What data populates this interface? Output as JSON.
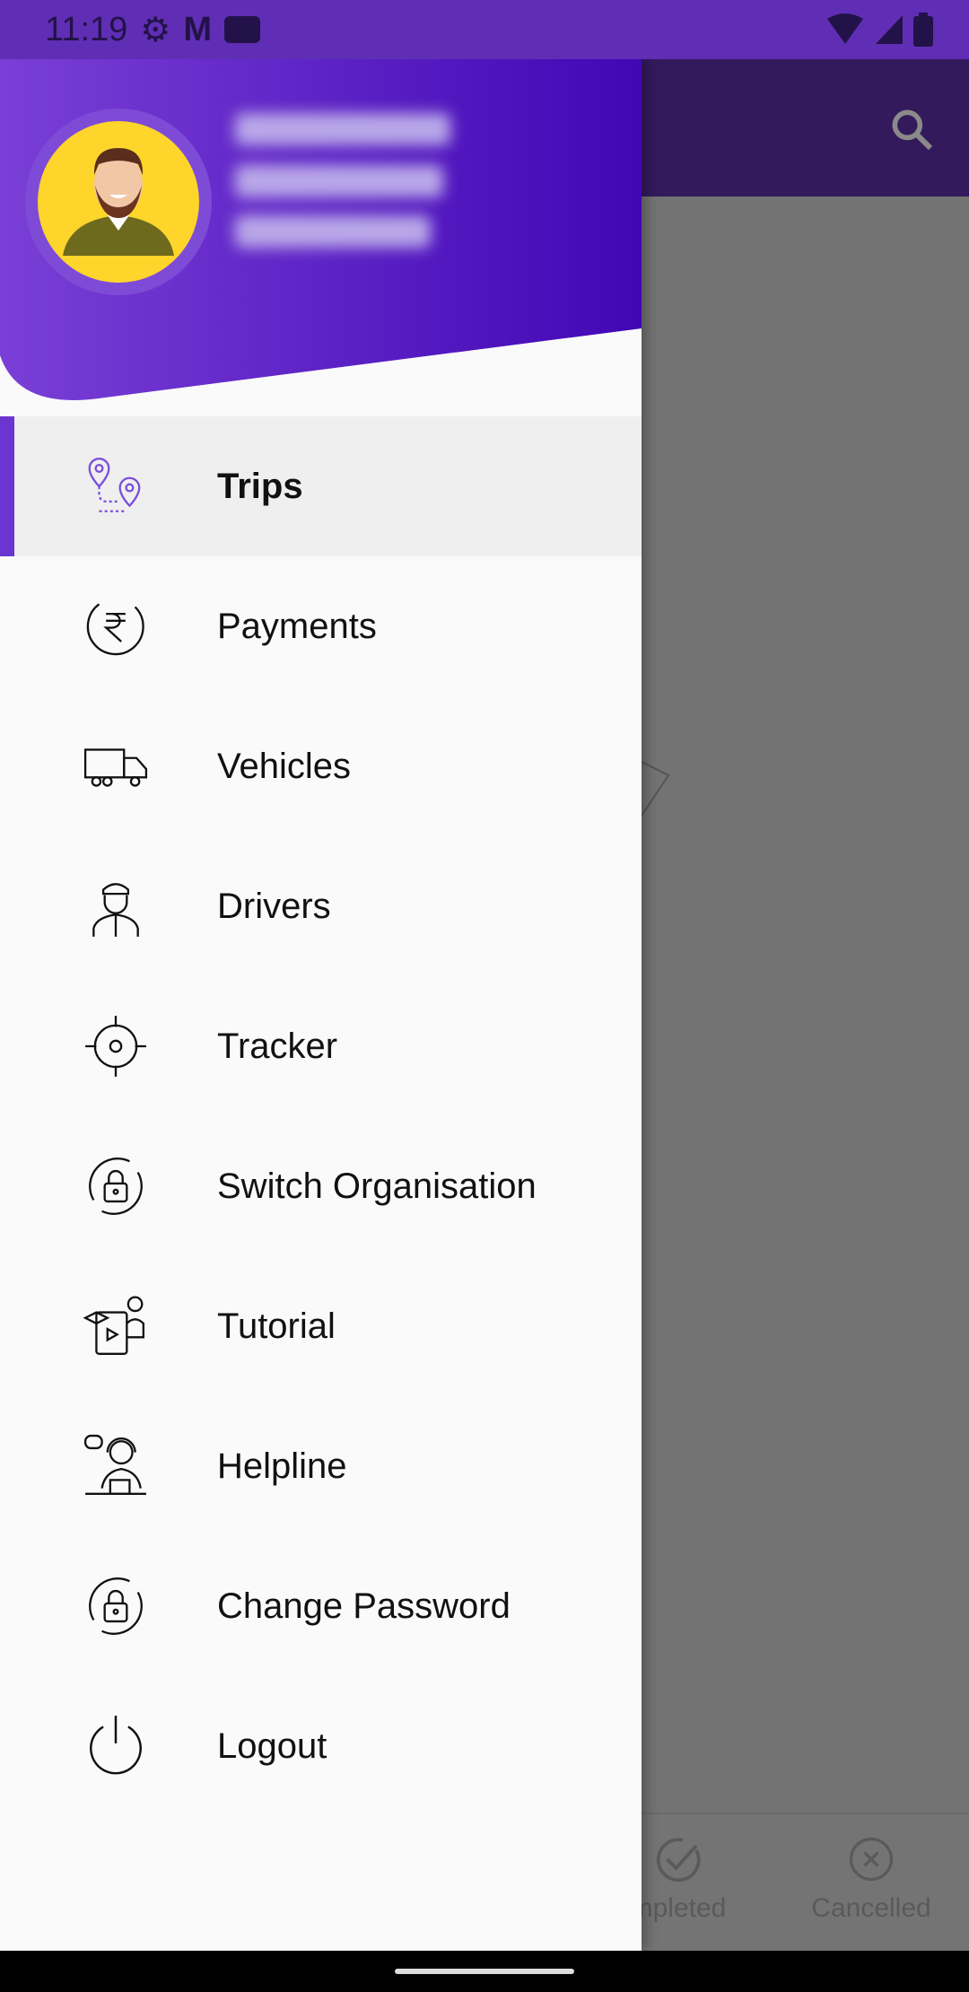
{
  "status_bar": {
    "time": "11:19",
    "icons": [
      "settings-icon",
      "gmail-icon",
      "youtube-icon",
      "wifi-icon",
      "signal-icon",
      "battery-icon"
    ]
  },
  "app_bar": {
    "icons": [
      "search-icon"
    ]
  },
  "drawer": {
    "profile": {
      "avatar": "user-avatar"
    },
    "items": [
      {
        "label": "Trips",
        "icon": "route-pin-icon",
        "active": true
      },
      {
        "label": "Payments",
        "icon": "rupee-cycle-icon"
      },
      {
        "label": "Vehicles",
        "icon": "truck-icon"
      },
      {
        "label": "Drivers",
        "icon": "driver-icon"
      },
      {
        "label": "Tracker",
        "icon": "target-icon"
      },
      {
        "label": "Switch Organisation",
        "icon": "lock-refresh-icon"
      },
      {
        "label": "Tutorial",
        "icon": "tutorial-icon"
      },
      {
        "label": "Helpline",
        "icon": "support-agent-icon"
      },
      {
        "label": "Change Password",
        "icon": "lock-refresh-icon"
      },
      {
        "label": "Logout",
        "icon": "power-icon"
      }
    ]
  },
  "bottom_nav": {
    "items": [
      {
        "label": "mpleted",
        "icon": "check-circle-icon"
      },
      {
        "label": "Cancelled",
        "icon": "x-circle-icon"
      }
    ]
  },
  "colors": {
    "accent": "#6a35d0",
    "header_start": "#7a3fd6",
    "header_end": "#4107b5",
    "status_bar": "#5f2eb4"
  }
}
